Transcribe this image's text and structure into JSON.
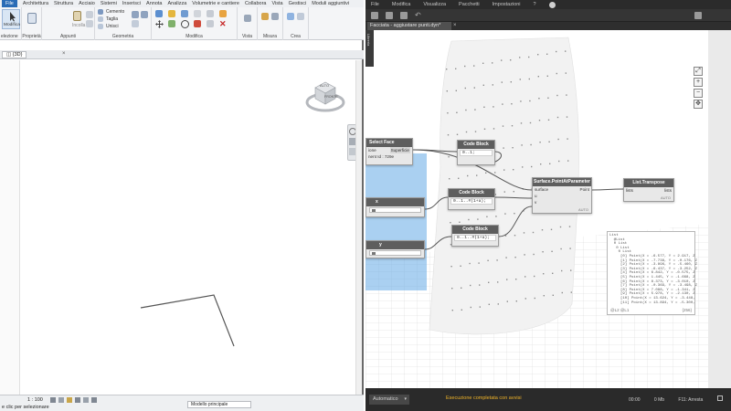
{
  "revit": {
    "menubar": {
      "file": "File",
      "items": [
        "Architettura",
        "Struttura",
        "Acciaio",
        "Sistemi",
        "Inserisci",
        "Annota",
        "Analizza",
        "Volumetrie e cantiere",
        "Collabora",
        "Vista",
        "Gestisci",
        "Moduli aggiuntivi"
      ]
    },
    "ribbon": {
      "modifica_btn": "Modifica",
      "selezione": "elezione",
      "proprieta": "Proprietà",
      "appunti": "Appunti",
      "incolla": "Incolla",
      "geometria": "Geometria",
      "cemento": "Cemento",
      "taglia": "Taglia",
      "unisci": "Unisci",
      "modifica_group": "Modifica",
      "vista": "Vista",
      "misura": "Misura",
      "crea": "Crea"
    },
    "view_tab": "{3D}",
    "viewcube": {
      "top": "ALTO",
      "front": "FRONTE"
    },
    "status": {
      "scale": "1 : 100",
      "hint": "e clic per selezionare",
      "model": "Modello principale"
    }
  },
  "dynamo": {
    "menu": [
      "File",
      "Modifica",
      "Visualizza",
      "Pacchetti",
      "Impostazioni",
      "?"
    ],
    "tab": "Facciata - aggiustare punti.dyn*",
    "side_label": "Libreria",
    "nodes": {
      "select_face": {
        "title": "Select Face",
        "port_in": "ione",
        "port_out": "Superficie",
        "info": "nent Id : 729e"
      },
      "code1": {
        "title": "Code Block",
        "code": "0..1;",
        "ref": "0"
      },
      "code2": {
        "title": "Code Block",
        "code": "0..1..#(1+a);"
      },
      "code3": {
        "title": "Code Block",
        "code": "0..1..#(1+a);"
      },
      "slider_x": {
        "title": "x"
      },
      "slider_y": {
        "title": "y"
      },
      "surface": {
        "title": "Surface.PointAtParameter",
        "in1": "surface",
        "in2": "u",
        "in3": "v",
        "out": "Point",
        "foot": "AUTO"
      },
      "transpose": {
        "title": "List.Transpose",
        "in": "lists",
        "out": "lists",
        "foot": "AUTO"
      }
    },
    "watch": {
      "lines": [
        "List",
        "  @List",
        "  0 List",
        "   0 List",
        "    0 List",
        "     [0] Point(X = -6.577, Y = 2.917, Z",
        "     [1] Point(X = -7.738, Y = -0.176, Z",
        "     [2] Point(X = -3.896, Y = -5.460, Z",
        "     [3] Point(X = -6.437, Y = -3.252, Z",
        "     [4] Point(X = 6.842, Y = -0.575, Z",
        "     [5] Point(X = 1.445, Y = -1.668, Z",
        "     [6] Point(X = 8.373, Y = -3.010, Z",
        "     [7] Point(X = -0.369, Y = -3.498, Z",
        "     [8] Point(X = 7.088, Y = -1.341, Z",
        "     [9] Point(X = 5.978, Y = -2.130, Z",
        "     [10] Point(X = 13.624, Y = -3.448,",
        "     [11] Point(X = 13.894, Y = -5.300,"
      ],
      "levels": "@L2 @L1",
      "count": "{256}"
    },
    "status": {
      "run_mode": "Automatico",
      "message": "Esecuzione completata con avvisi",
      "time": "00:00",
      "memory": "0 Mb",
      "stop": "F11: Arresta"
    }
  }
}
